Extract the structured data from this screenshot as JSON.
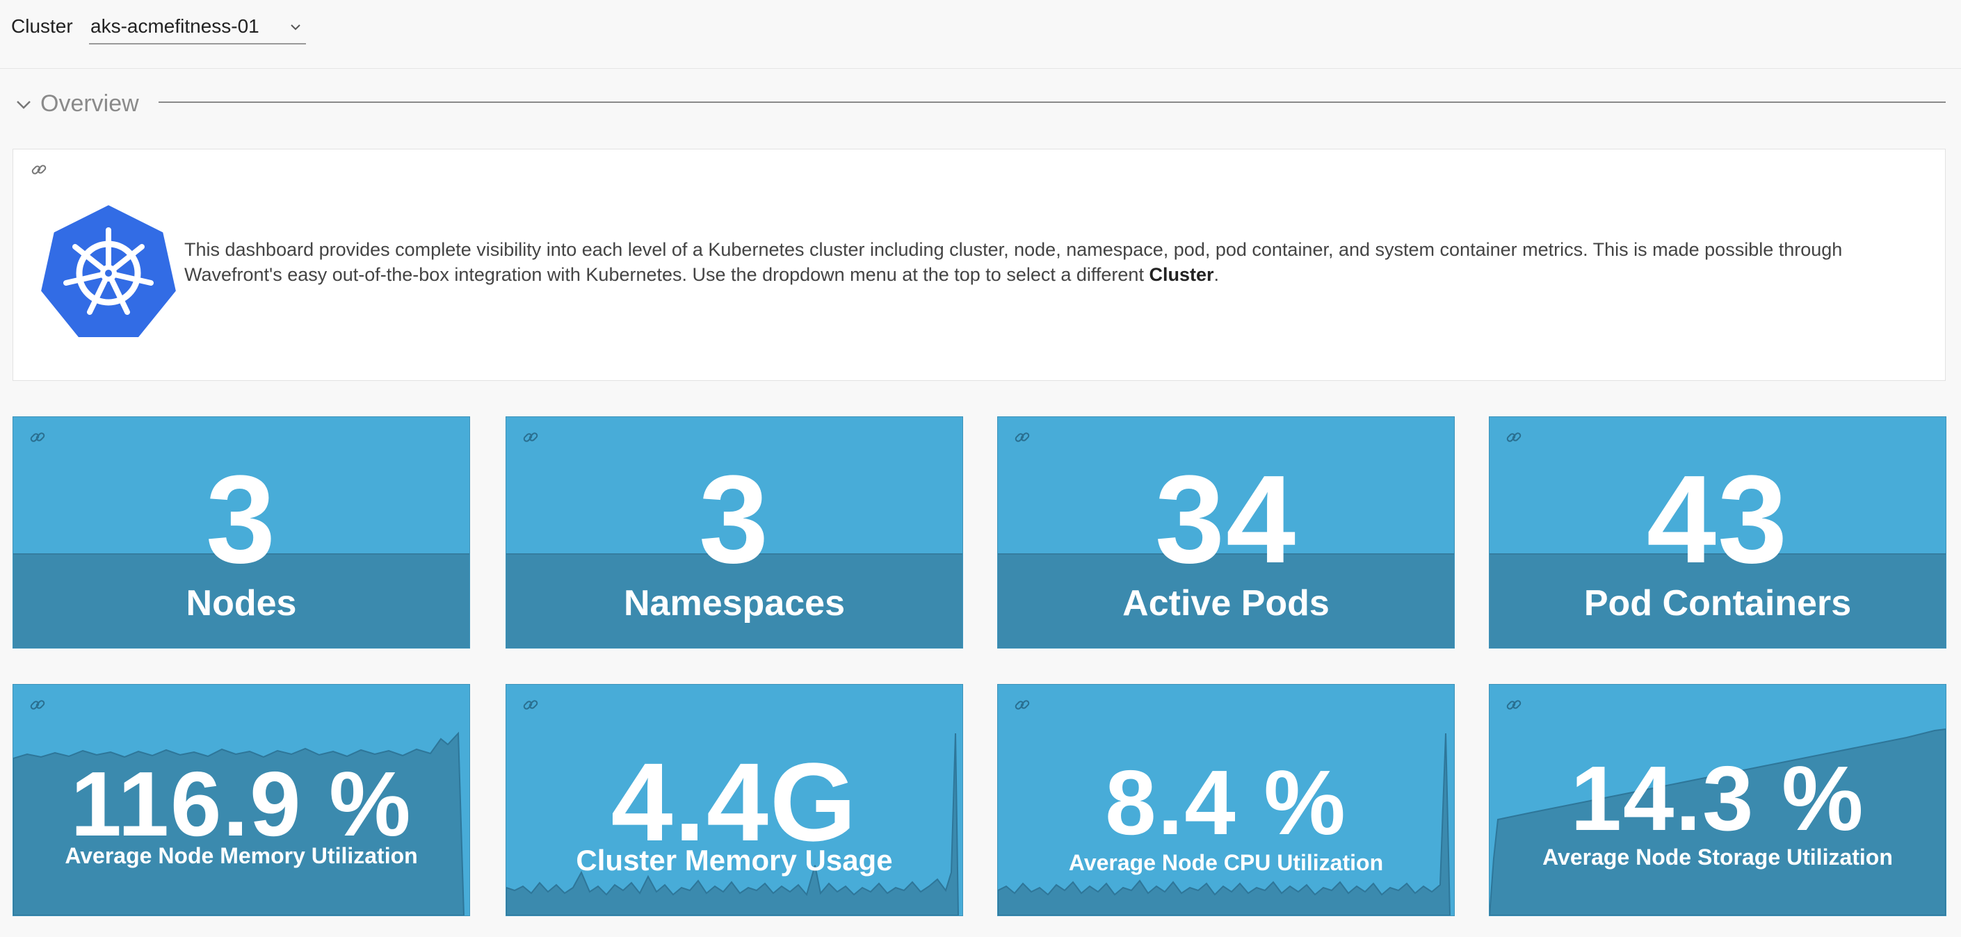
{
  "filter": {
    "label": "Cluster",
    "selected": "aks-acmefitness-01"
  },
  "section": {
    "title": "Overview"
  },
  "description": {
    "text_before": "This dashboard provides complete visibility into each level of a Kubernetes cluster including cluster, node, namespace, pod, pod container, and system container metrics. This is made possible through Wavefront's easy out-of-the-box integration with Kubernetes. Use the dropdown menu at the top to select a different ",
    "text_bold": "Cluster",
    "text_after": "."
  },
  "tiles": [
    {
      "value": "3",
      "label": "Nodes"
    },
    {
      "value": "3",
      "label": "Namespaces"
    },
    {
      "value": "34",
      "label": "Active Pods"
    },
    {
      "value": "43",
      "label": "Pod Containers"
    }
  ],
  "metrics": [
    {
      "value": "116.9 %",
      "label": "Average Node Memory Utilization"
    },
    {
      "value": "4.4G",
      "label": "Cluster Memory Usage"
    },
    {
      "value": "8.4 %",
      "label": "Average Node CPU Utilization"
    },
    {
      "value": "14.3 %",
      "label": "Average Node Storage Utilization"
    }
  ],
  "colors": {
    "tile_bg": "#48acd8",
    "tile_band": "#3b8aae",
    "k8s_blue": "#326ce5"
  }
}
